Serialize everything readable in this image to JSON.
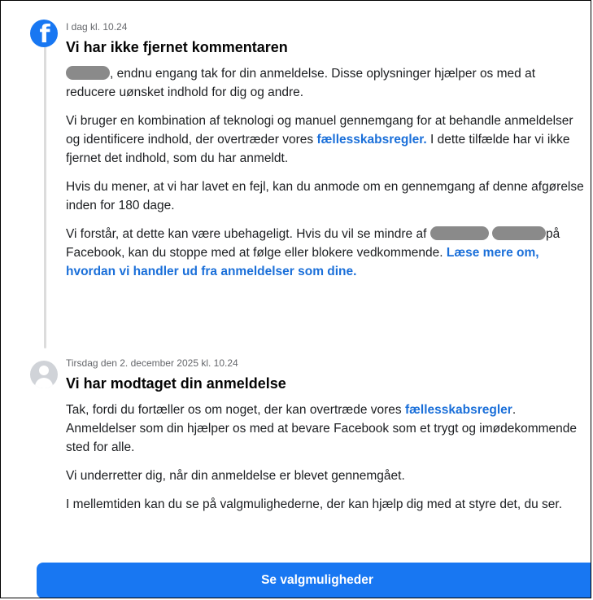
{
  "notification_1": {
    "timestamp": "I dag kl. 10.24",
    "title": "Vi har ikke fjernet kommentaren",
    "p1_text": ", endnu engang tak for din anmeldelse. Disse oplysninger hjælper os med at reducere uønsket indhold for dig og andre.",
    "p2_before": "Vi bruger en kombination af teknologi og manuel gennemgang for at behandle anmeldelser og identificere indhold, der overtræder vores ",
    "p2_link": "fællesskabsregler.",
    "p2_after": " I dette tilfælde har vi ikke fjernet det indhold, som du har anmeldt.",
    "p3_text": "Hvis du mener, at vi har lavet en fejl, kan du anmode om en gennemgang af denne afgørelse inden for 180 dage.",
    "p4_before": "Vi forstår, at dette kan være ubehageligt. Hvis du vil se mindre af ",
    "p4_middle": "på Facebook, kan du stoppe med at følge eller blokere vedkommende. ",
    "p4_link": "Læse mere om, hvordan vi handler ud fra anmeldelser som dine."
  },
  "notification_2": {
    "timestamp": "Tirsdag den 2. december 2025 kl. 10.24",
    "title": "Vi har modtaget din anmeldelse",
    "p1_before": "Tak, fordi du fortæller os om noget, der kan overtræde vores ",
    "p1_link": "fællesskabsregler",
    "p1_after": ". Anmeldelser som din hjælper os med at bevare Facebook som et trygt og imødekommende sted for alle.",
    "p2_text": "Vi underretter dig, når din anmeldelse er blevet gennemgået.",
    "p3_text": "I mellemtiden kan du se på valgmulighederne, der kan hjælp dig med at styre det, du ser."
  },
  "cta": {
    "label": "Se valgmuligheder"
  },
  "icons": {
    "brand": "facebook-logo-icon",
    "user": "default-avatar-icon"
  },
  "colors": {
    "brand_blue": "#1877f2",
    "link_blue": "#1a6fd9",
    "meta_gray": "#65676b",
    "redaction": "#8a8a8a"
  }
}
